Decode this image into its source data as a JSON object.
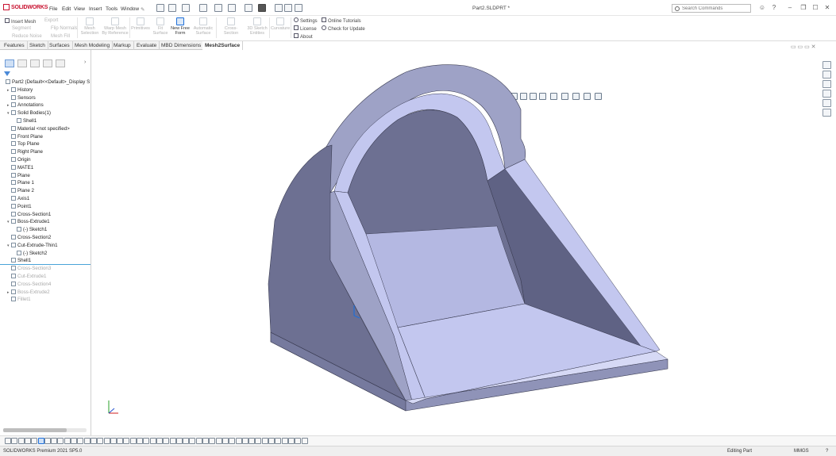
{
  "app": {
    "name": "SOLIDWORKS",
    "document_title": "Part2.SLDPRT *",
    "search_placeholder": "Search Commands"
  },
  "menus": [
    "File",
    "Edit",
    "View",
    "Insert",
    "Tools",
    "Window"
  ],
  "command_manager": {
    "left_group": {
      "insert_mesh": "Insert Mesh",
      "export": "Export",
      "segment": "Segment",
      "flip_normals": "Flip Normals",
      "reduce_noise": "Reduce Noise",
      "mesh_fill": "Mesh Fill"
    },
    "buttons": [
      {
        "label1": "Mesh",
        "label2": "Selection",
        "active": false
      },
      {
        "label1": "Warp Mesh",
        "label2": "By Reference",
        "active": false
      },
      {
        "label1": "Primitives",
        "label2": "",
        "active": false
      },
      {
        "label1": "Fit",
        "label2": "Surface",
        "active": false
      },
      {
        "label1": "New Free",
        "label2": "Form",
        "active": true
      },
      {
        "label1": "Automatic",
        "label2": "Surface",
        "active": false
      },
      {
        "label1": "Cross-Section",
        "label2": "",
        "active": false
      },
      {
        "label1": "3D Sketch",
        "label2": "Entities",
        "active": false
      },
      {
        "label1": "Curvature",
        "label2": "",
        "active": false
      }
    ],
    "right_links": {
      "settings": "Settings",
      "online_tutorials": "Online Tutorials",
      "license": "License",
      "check_for_update": "Check for Update",
      "about": "About"
    }
  },
  "tabs": [
    {
      "label": "Features",
      "active": false
    },
    {
      "label": "Sketch",
      "active": false
    },
    {
      "label": "Surfaces",
      "active": false
    },
    {
      "label": "Mesh Modeling",
      "active": false
    },
    {
      "label": "Markup",
      "active": false
    },
    {
      "label": "Evaluate",
      "active": false
    },
    {
      "label": "MBD Dimensions",
      "active": false
    },
    {
      "label": "Mesh2Surface",
      "active": true
    }
  ],
  "feature_tree": [
    {
      "label": "Part2  (Default<<Default>_Display S",
      "expander": "",
      "dim": false,
      "indent": 0
    },
    {
      "label": "History",
      "expander": "▸",
      "dim": false,
      "indent": 1
    },
    {
      "label": "Sensors",
      "expander": "",
      "dim": false,
      "indent": 1
    },
    {
      "label": "Annotations",
      "expander": "▸",
      "dim": false,
      "indent": 1
    },
    {
      "label": "Solid Bodies(1)",
      "expander": "▾",
      "dim": false,
      "indent": 1
    },
    {
      "label": "Shell1",
      "expander": "",
      "dim": false,
      "indent": 2
    },
    {
      "label": "Material <not specified>",
      "expander": "",
      "dim": false,
      "indent": 1
    },
    {
      "label": "Front Plane",
      "expander": "",
      "dim": false,
      "indent": 1
    },
    {
      "label": "Top Plane",
      "expander": "",
      "dim": false,
      "indent": 1
    },
    {
      "label": "Right Plane",
      "expander": "",
      "dim": false,
      "indent": 1
    },
    {
      "label": "Origin",
      "expander": "",
      "dim": false,
      "indent": 1
    },
    {
      "label": "MATE1",
      "expander": "",
      "dim": false,
      "indent": 1
    },
    {
      "label": "Plane",
      "expander": "",
      "dim": false,
      "indent": 1
    },
    {
      "label": "Plane 1",
      "expander": "",
      "dim": false,
      "indent": 1
    },
    {
      "label": "Plane 2",
      "expander": "",
      "dim": false,
      "indent": 1
    },
    {
      "label": "Axis1",
      "expander": "",
      "dim": false,
      "indent": 1
    },
    {
      "label": "Point1",
      "expander": "",
      "dim": false,
      "indent": 1
    },
    {
      "label": "Cross-Section1",
      "expander": "",
      "dim": false,
      "indent": 1
    },
    {
      "label": "Boss-Extrude1",
      "expander": "▾",
      "dim": false,
      "indent": 1
    },
    {
      "label": "(-) Sketch1",
      "expander": "",
      "dim": false,
      "indent": 2
    },
    {
      "label": "Cross-Section2",
      "expander": "",
      "dim": false,
      "indent": 1
    },
    {
      "label": "Cut-Extrude-Thin1",
      "expander": "▾",
      "dim": false,
      "indent": 1
    },
    {
      "label": "(-) Sketch2",
      "expander": "",
      "dim": false,
      "indent": 2
    },
    {
      "label": "Shell1",
      "expander": "",
      "dim": false,
      "indent": 1
    },
    {
      "label": "Cross-Section3",
      "expander": "",
      "dim": true,
      "indent": 1
    },
    {
      "label": "Cut-Extrude1",
      "expander": "",
      "dim": true,
      "indent": 1
    },
    {
      "label": "Cross-Section4",
      "expander": "",
      "dim": true,
      "indent": 1
    },
    {
      "label": "Boss-Extrude2",
      "expander": "▸",
      "dim": true,
      "indent": 1
    },
    {
      "label": "Fillet1",
      "expander": "",
      "dim": true,
      "indent": 1
    }
  ],
  "status": {
    "product": "SOLIDWORKS Premium 2021 SP5.0",
    "mode": "Editing Part",
    "units": "MMGS"
  },
  "colors": {
    "model_face_light": "#c3c7ef",
    "model_face_mid": "#8f93b8",
    "model_face_dark": "#6d7092",
    "model_edge": "#3a3c52",
    "accent": "#1e6fd9"
  }
}
